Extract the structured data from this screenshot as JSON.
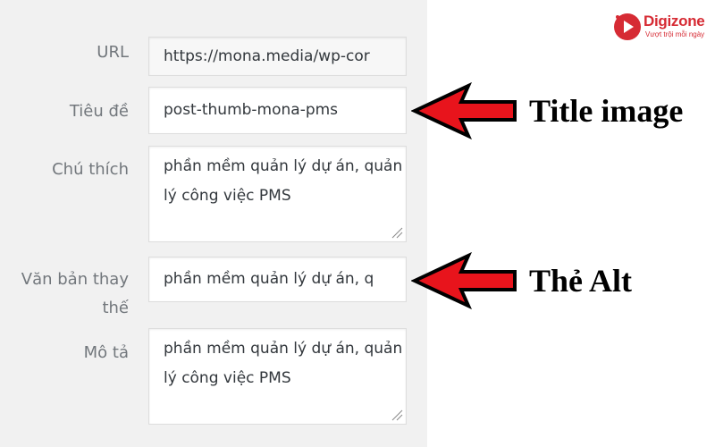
{
  "brand": {
    "name": "Digizone",
    "tagline": "Vượt trội mỗi ngày",
    "color": "#d62b34"
  },
  "fields": {
    "url": {
      "label": "URL",
      "value": "https://mona.media/wp-cor"
    },
    "title": {
      "label": "Tiêu đề",
      "value": "post-thumb-mona-pms"
    },
    "caption": {
      "label": "Chú thích",
      "value": "phần mềm quản lý dự án, quản lý công việc PMS"
    },
    "alt": {
      "label_line1": "Văn bản thay",
      "label_line2": "thế",
      "value": "phần mềm quản lý dự án, q"
    },
    "description": {
      "label": "Mô tả",
      "value": "phần mềm quản lý dự án, quản lý công việc PMS"
    }
  },
  "annotations": {
    "title_image": "Title image",
    "alt_tag": "Thẻ Alt",
    "arrow_color": "#e8141c"
  }
}
